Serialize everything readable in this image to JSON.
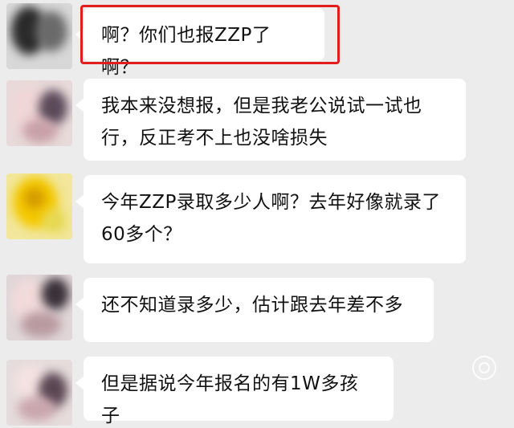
{
  "messages": [
    {
      "text": "啊？你们也报ZZP了啊？",
      "highlighted": true
    },
    {
      "text": "我本来没想报，但是我老公说试一试也行，反正考不上也没啥损失",
      "highlighted": false
    },
    {
      "text": "今年ZZP录取多少人啊？去年好像就录了60多个？",
      "highlighted": false
    },
    {
      "text": "还不知道录多少，估计跟去年差不多",
      "highlighted": false
    },
    {
      "text": "但是据说今年报名的有1W多孩子",
      "highlighted": false
    }
  ],
  "colors": {
    "background": "#ececec",
    "bubble": "#ffffff",
    "highlight_border": "#e41c1c"
  },
  "icons": [
    "user-avatar-blurred"
  ]
}
